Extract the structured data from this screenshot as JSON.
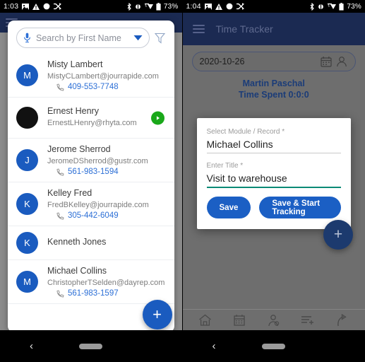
{
  "left": {
    "status_bar": {
      "time": "1:03",
      "battery": "73%",
      "icons": [
        "image-icon",
        "warning-icon",
        "circle-icon",
        "shuffle-icon",
        "bluetooth-icon",
        "vibrate-icon",
        "wifi-icon",
        "battery-icon"
      ]
    },
    "app_bar": {
      "menu_icon": "hamburger-menu-icon"
    },
    "search": {
      "placeholder": "Search by First Name",
      "mic_icon": "microphone-icon",
      "dropdown_icon": "chevron-down-icon",
      "filter_icon": "filter-funnel-icon"
    },
    "contacts": [
      {
        "initial": "M",
        "name": "Misty Lambert",
        "email": "MistyCLambert@jourrapide.com",
        "phone": "409-553-7748",
        "avatar_color": "#1a5bbf",
        "has_play": false
      },
      {
        "initial": "",
        "name": "Ernest Henry",
        "email": "ErnestLHenry@rhyta.com",
        "phone": "",
        "avatar_color": "#111111",
        "has_play": true
      },
      {
        "initial": "J",
        "name": "Jerome Sherrod",
        "email": "JeromeDSherrod@gustr.com",
        "phone": "561-983-1594",
        "avatar_color": "#1a5bbf",
        "has_play": false
      },
      {
        "initial": "K",
        "name": "Kelley Fred",
        "email": "FredBKelley@jourrapide.com",
        "phone": "305-442-6049",
        "avatar_color": "#1a5bbf",
        "has_play": false
      },
      {
        "initial": "K",
        "name": "Kenneth Jones",
        "email": "",
        "phone": "",
        "avatar_color": "#1a5bbf",
        "has_play": false
      },
      {
        "initial": "M",
        "name": "Michael Collins",
        "email": "ChristopherTSelden@dayrep.com",
        "phone": "561-983-1597",
        "avatar_color": "#1a5bbf",
        "has_play": false
      }
    ],
    "fab_label": "+",
    "nav": {
      "back_icon": "back-chevron-icon",
      "home_pill": "home-pill-icon"
    }
  },
  "right": {
    "status_bar": {
      "time": "1:04",
      "battery": "73%"
    },
    "app_bar": {
      "menu_icon": "hamburger-menu-icon",
      "title": "Time Tracker"
    },
    "date_field": {
      "value": "2020-10-26",
      "calendar_icon": "calendar-icon",
      "person_icon": "person-icon"
    },
    "summary": {
      "user_name": "Martin Paschal",
      "time_spent": "Time Spent 0:0:0"
    },
    "dialog": {
      "fields": [
        {
          "label": "Select Module / Record *",
          "value": "Michael Collins",
          "focused": false
        },
        {
          "label": "Enter Title *",
          "value": "Visit to warehouse",
          "focused": true
        }
      ],
      "buttons": [
        {
          "label": "Save"
        },
        {
          "label": "Save & Start Tracking"
        }
      ]
    },
    "fab_label": "+",
    "bottom_nav": [
      "home-icon",
      "calendar-icon",
      "person-icon",
      "list-add-icon",
      "share-arrow-icon"
    ],
    "nav": {
      "back_icon": "back-chevron-icon",
      "home_pill": "home-pill-icon"
    }
  },
  "colors": {
    "app_bar": "#1b2a52",
    "accent_blue": "#1a5bbf",
    "link_blue": "#2c6fd6",
    "focus_teal": "#0b8a76",
    "play_green": "#1aa81a"
  }
}
